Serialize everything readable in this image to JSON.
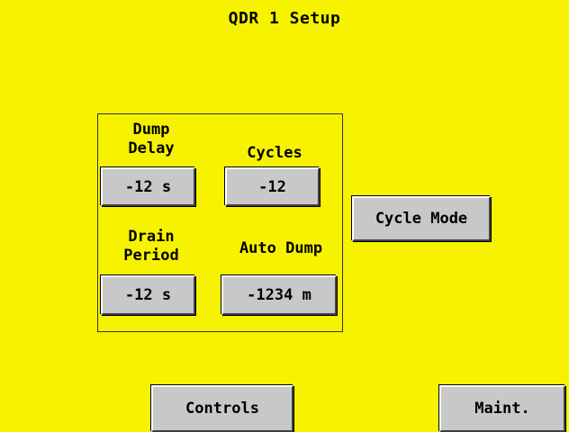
{
  "title": "QDR 1 Setup",
  "panel": {
    "dump_delay": {
      "label": "Dump\nDelay",
      "value": "-12 s"
    },
    "cycles": {
      "label": "Cycles",
      "value": "-12"
    },
    "drain_period": {
      "label": "Drain\nPeriod",
      "value": "-12 s"
    },
    "auto_dump": {
      "label": "Auto Dump",
      "value": "-1234 m"
    }
  },
  "buttons": {
    "cycle_mode": "Cycle Mode",
    "controls": "Controls",
    "maint": "Maint."
  },
  "colors": {
    "background": "#f7f200",
    "button_face": "#c8c8c8"
  }
}
